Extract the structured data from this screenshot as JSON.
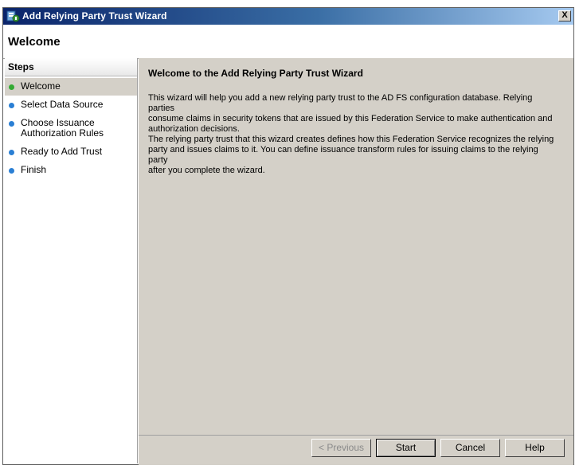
{
  "window": {
    "title": "Add Relying Party Trust Wizard",
    "close_label": "X"
  },
  "header": {
    "title": "Welcome"
  },
  "sidebar": {
    "heading": "Steps",
    "steps": [
      {
        "label": "Welcome",
        "status": "current"
      },
      {
        "label": "Select Data Source",
        "status": "pending"
      },
      {
        "label": "Choose Issuance Authorization Rules",
        "status": "pending",
        "label_line1": "Choose Issuance",
        "label_line2": "Authorization Rules"
      },
      {
        "label": "Ready to Add Trust",
        "status": "pending"
      },
      {
        "label": "Finish",
        "status": "pending"
      }
    ]
  },
  "main": {
    "title": "Welcome to the Add Relying Party Trust Wizard",
    "paragraph1_lines": [
      "This wizard will help you add a new relying party trust to the AD FS configuration database.  Relying parties",
      "consume claims in security tokens that are issued by this Federation Service to make authentication and",
      "authorization decisions."
    ],
    "paragraph2_lines": [
      "The relying party trust that this wizard creates defines how this Federation Service recognizes the relying",
      "party and issues claims to it. You can define issuance transform rules for issuing claims to the relying party",
      "after you complete the wizard."
    ]
  },
  "footer": {
    "previous_label": "< Previous",
    "start_label": "Start",
    "cancel_label": "Cancel",
    "help_label": "Help"
  },
  "colors": {
    "current_step": "#33aa33",
    "pending_step": "#2a7fd4",
    "title_start": "#0a246a"
  }
}
